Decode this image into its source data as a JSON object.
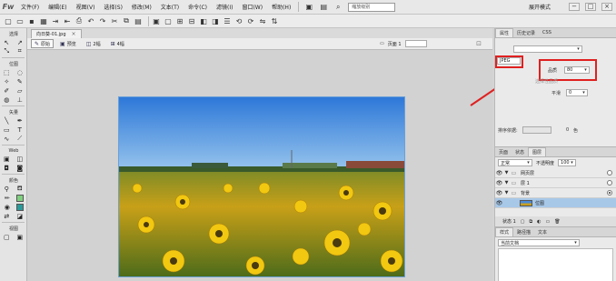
{
  "app": {
    "logo": "Fw",
    "menu": [
      "文件(F)",
      "编辑(E)",
      "视图(V)",
      "选择(S)",
      "修改(M)",
      "文本(T)",
      "命令(C)",
      "滤镜(I)",
      "窗口(W)",
      "帮助(H)"
    ],
    "zoom_value": "缩放级别",
    "workspace": "展开模式",
    "window_buttons": [
      "−",
      "□",
      "×"
    ]
  },
  "tools": {
    "groups": [
      "选择",
      "位图",
      "矢量",
      "Web",
      "颜色",
      "视图"
    ]
  },
  "document": {
    "tab_name": "向日葵-01.jpg",
    "tab_close": "×",
    "view_tabs": [
      "原始",
      "预览",
      "2幅",
      "4幅"
    ],
    "page_label": "页面 1"
  },
  "properties": {
    "tabs": [
      "属性",
      "历史记录",
      "CSS"
    ],
    "export_label": "JPEG",
    "quality_label": "品质",
    "quality_value": "80",
    "smoothing_label": "平滑",
    "smoothing_value": "0",
    "sort_label": "排序依据:",
    "color_count": "0",
    "color_unit": "色",
    "partial_label": "选",
    "partial_label2": "选择性品质"
  },
  "layers": {
    "tabs": [
      "页面",
      "状态",
      "图层"
    ],
    "blend_mode": "正常",
    "opacity_label": "不透明度",
    "opacity_value": "100",
    "rows": [
      {
        "name": "网页层"
      },
      {
        "name": "层 1"
      },
      {
        "name": "背景"
      },
      {
        "name": "位图"
      }
    ],
    "footer_label": "状态 1"
  },
  "styles": {
    "tabs": [
      "样式",
      "路径描",
      "文本"
    ],
    "select_value": "当前文档"
  },
  "colors": {
    "highlight": "#e02020",
    "sky_top": "#2d78d8",
    "sky_bottom": "#8fc2ee",
    "field": "#c8a018"
  }
}
